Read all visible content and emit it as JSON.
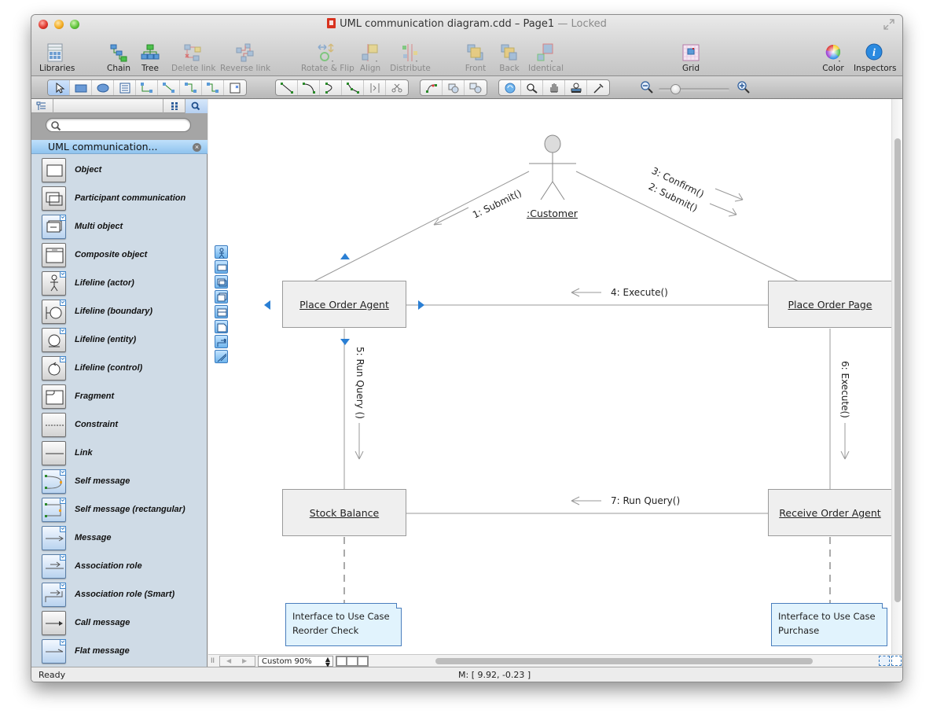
{
  "window": {
    "title": "UML communication diagram.cdd – Page1",
    "status_suffix": "— Locked",
    "doc_icon": "document-icon",
    "fullscreen_icon": "fullscreen-arrows-icon"
  },
  "toolbar": {
    "buttons": [
      {
        "label": "Libraries",
        "icon": "libraries-grid-icon",
        "enabled": true
      },
      {
        "label": "Chain",
        "icon": "chain-icon",
        "enabled": true
      },
      {
        "label": "Tree",
        "icon": "tree-icon",
        "enabled": true
      },
      {
        "label": "Delete link",
        "icon": "delete-link-icon",
        "enabled": false
      },
      {
        "label": "Reverse link",
        "icon": "reverse-link-icon",
        "enabled": false
      },
      {
        "label": "Rotate & Flip",
        "icon": "rotate-flip-icon",
        "enabled": false
      },
      {
        "label": "Align",
        "icon": "align-icon",
        "enabled": false
      },
      {
        "label": "Distribute",
        "icon": "distribute-icon",
        "enabled": false
      },
      {
        "label": "Front",
        "icon": "bring-front-icon",
        "enabled": false
      },
      {
        "label": "Back",
        "icon": "send-back-icon",
        "enabled": false
      },
      {
        "label": "Identical",
        "icon": "identical-icon",
        "enabled": false
      },
      {
        "label": "Grid",
        "icon": "grid-icon",
        "enabled": true
      },
      {
        "label": "Color",
        "icon": "color-wheel-icon",
        "enabled": true
      },
      {
        "label": "Inspectors",
        "icon": "info-icon",
        "enabled": true
      }
    ]
  },
  "drawing_tools": {
    "group1": [
      "pointer-tool",
      "rectangle-tool",
      "ellipse-tool",
      "text-tool",
      "orthogonal-connector-tool",
      "straight-connector-tool",
      "smart-connector-tool",
      "round-connector-tool",
      "insert-object-tool"
    ],
    "group2": [
      "line-tool",
      "arc-tool",
      "bezier-tool",
      "polyline-tool",
      "freehand-tool",
      "scissors-tool"
    ],
    "group3": [
      "edit-points-tool",
      "group-tool",
      "ungroup-tool"
    ],
    "group4": [
      "rotate-view-tool",
      "zoom-tool",
      "pan-hand-tool",
      "stamp-tool",
      "eyedropper-tool"
    ],
    "zoom_level": 0.2
  },
  "sidebar": {
    "search_placeholder": "",
    "library_name": "UML communication...",
    "items": [
      {
        "label": "Object",
        "style": "gray",
        "checked": false,
        "icon": "object-shape-icon"
      },
      {
        "label": "Participant communication",
        "style": "gray",
        "checked": false,
        "icon": "participant-shape-icon"
      },
      {
        "label": "Multi object",
        "style": "blue",
        "checked": true,
        "icon": "multi-object-shape-icon"
      },
      {
        "label": "Composite object",
        "style": "gray",
        "checked": false,
        "icon": "composite-object-shape-icon"
      },
      {
        "label": "Lifeline (actor)",
        "style": "gray",
        "checked": true,
        "icon": "actor-shape-icon"
      },
      {
        "label": "Lifeline (boundary)",
        "style": "gray",
        "checked": true,
        "icon": "boundary-shape-icon"
      },
      {
        "label": "Lifeline (entity)",
        "style": "gray",
        "checked": true,
        "icon": "entity-shape-icon"
      },
      {
        "label": "Lifeline (control)",
        "style": "gray",
        "checked": true,
        "icon": "control-shape-icon"
      },
      {
        "label": "Fragment",
        "style": "gray",
        "checked": false,
        "icon": "fragment-shape-icon"
      },
      {
        "label": "Constraint",
        "style": "gray",
        "checked": false,
        "icon": "constraint-shape-icon"
      },
      {
        "label": "Link",
        "style": "gray",
        "checked": false,
        "icon": "link-shape-icon"
      },
      {
        "label": "Self message",
        "style": "blue",
        "checked": true,
        "icon": "self-message-shape-icon"
      },
      {
        "label": "Self message (rectangular)",
        "style": "blue",
        "checked": true,
        "icon": "self-message-rect-shape-icon"
      },
      {
        "label": "Message",
        "style": "blue",
        "checked": true,
        "icon": "message-shape-icon"
      },
      {
        "label": "Association role",
        "style": "blue",
        "checked": true,
        "icon": "association-role-shape-icon"
      },
      {
        "label": "Association role (Smart)",
        "style": "blue",
        "checked": true,
        "icon": "association-role-smart-shape-icon"
      },
      {
        "label": "Call message",
        "style": "gray",
        "checked": false,
        "icon": "call-message-shape-icon"
      },
      {
        "label": "Flat message",
        "style": "blue",
        "checked": true,
        "icon": "flat-message-shape-icon"
      }
    ]
  },
  "diagram": {
    "actor": {
      "label": ":Customer"
    },
    "nodes": [
      {
        "id": "poa",
        "label": "Place Order Agent"
      },
      {
        "id": "pop",
        "label": "Place Order Page"
      },
      {
        "id": "sb",
        "label": "Stock Balance"
      },
      {
        "id": "roa",
        "label": "Receive Order Agent"
      }
    ],
    "messages": [
      {
        "label": "1: Submit()"
      },
      {
        "label": "3: Confirm()"
      },
      {
        "label": "2: Submit()"
      },
      {
        "label": "4: Execute()"
      },
      {
        "label": "5: Run Query ()"
      },
      {
        "label": "6: Execute()"
      },
      {
        "label": "7: Run Query()"
      }
    ],
    "notes": [
      {
        "line1": "Interface to Use Case",
        "line2": "Reorder Check"
      },
      {
        "line1": "Interface to Use Case",
        "line2": "Purchase"
      }
    ]
  },
  "quick_shapes": [
    "actor-quick-icon",
    "object-quick-icon",
    "participant-quick-icon",
    "multi-object-quick-icon",
    "composite-quick-icon",
    "note-quick-icon",
    "association-quick-icon",
    "message-quick-icon"
  ],
  "bottom_bar": {
    "zoom_value": "Custom 90%"
  },
  "status": {
    "text": "Ready",
    "mouse_coords": "M: [ 9.92, -0.23 ]"
  }
}
